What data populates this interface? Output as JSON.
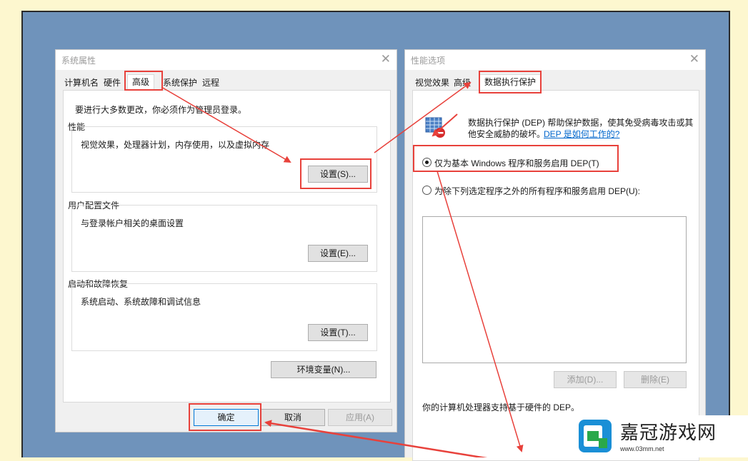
{
  "left_dialog": {
    "title": "系统属性",
    "tabs": [
      "计算机名",
      "硬件",
      "高级",
      "系统保护",
      "远程"
    ],
    "admin_note": "要进行大多数更改，你必须作为管理员登录。",
    "performance": {
      "label": "性能",
      "desc": "视觉效果，处理器计划，内存使用，以及虚拟内存",
      "button": "设置(S)..."
    },
    "user_profiles": {
      "label": "用户配置文件",
      "desc": "与登录帐户相关的桌面设置",
      "button": "设置(E)..."
    },
    "startup_recovery": {
      "label": "启动和故障恢复",
      "desc": "系统启动、系统故障和调试信息",
      "button": "设置(T)..."
    },
    "env_button": "环境变量(N)...",
    "ok": "确定",
    "cancel": "取消",
    "apply": "应用(A)"
  },
  "right_dialog": {
    "title": "性能选项",
    "tabs": [
      "视觉效果",
      "高级",
      "数据执行保护"
    ],
    "desc_line1": "数据执行保护 (DEP) 帮助保护数据，使其免受病毒攻击或其",
    "desc_line2": "他安全威胁的破坏。",
    "link": "DEP 是如何工作的?",
    "option1": "仅为基本 Windows 程序和服务启用 DEP(T)",
    "option2": "为除下列选定程序之外的所有程序和服务启用 DEP(U):",
    "add_button": "添加(D)...",
    "remove_button": "删除(E)",
    "support_text": "你的计算机处理器支持基于硬件的 DEP。"
  },
  "watermark": {
    "name": "嘉冠游戏网",
    "url": "www.03mm.net"
  },
  "colors": {
    "highlight": "#e8413b",
    "desktop": "#6f93bb",
    "page_bg": "#fdf7cf",
    "link": "#0066cc"
  }
}
